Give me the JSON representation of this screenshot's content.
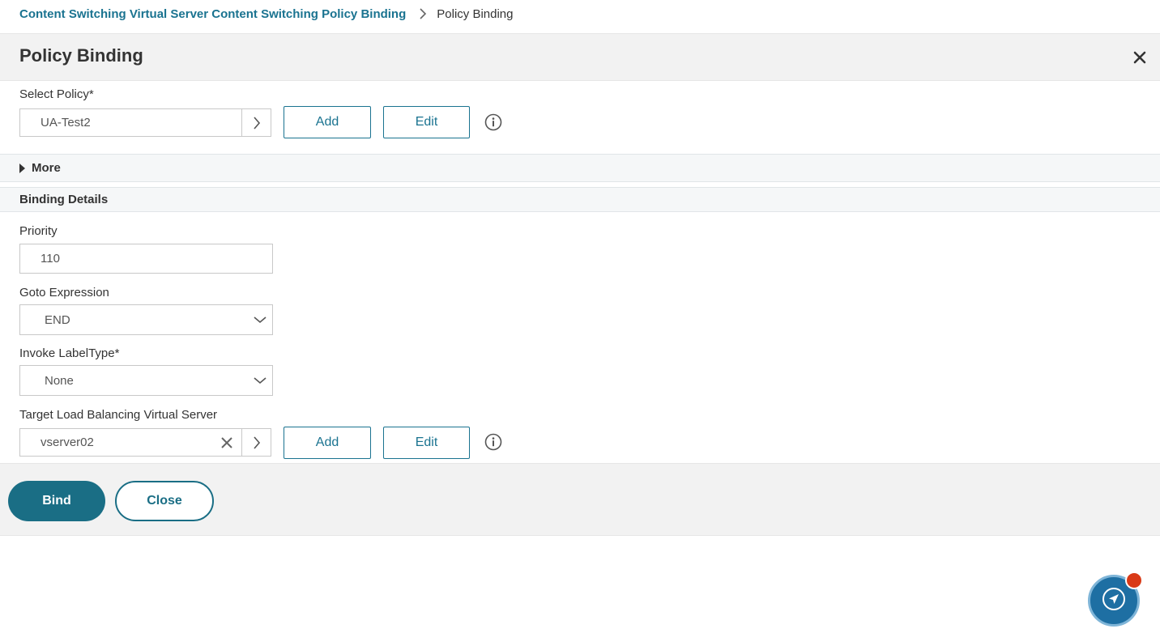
{
  "breadcrumb": {
    "parent": "Content Switching Virtual Server Content Switching Policy Binding",
    "current": "Policy Binding"
  },
  "header": {
    "title": "Policy Binding"
  },
  "select_policy": {
    "label": "Select Policy*",
    "value": "UA-Test2",
    "add_label": "Add",
    "edit_label": "Edit"
  },
  "more": {
    "label": "More"
  },
  "binding_details": {
    "title": "Binding Details",
    "priority": {
      "label": "Priority",
      "value": "110"
    },
    "goto_expression": {
      "label": "Goto Expression",
      "value": "END"
    },
    "invoke_label_type": {
      "label": "Invoke LabelType*",
      "value": "None"
    },
    "target_lb_vserver": {
      "label": "Target Load Balancing Virtual Server",
      "value": "vserver02",
      "add_label": "Add",
      "edit_label": "Edit"
    }
  },
  "footer": {
    "bind_label": "Bind",
    "close_label": "Close"
  },
  "colors": {
    "accent": "#1a7390",
    "primary_button": "#1a6e85",
    "fab": "#1e6fa3",
    "badge": "#d93a17"
  },
  "icons": [
    "chevron-right-icon",
    "close-icon",
    "info-icon",
    "triangle-right-icon",
    "chevron-down-icon",
    "clear-icon",
    "navigation-arrow-icon"
  ]
}
